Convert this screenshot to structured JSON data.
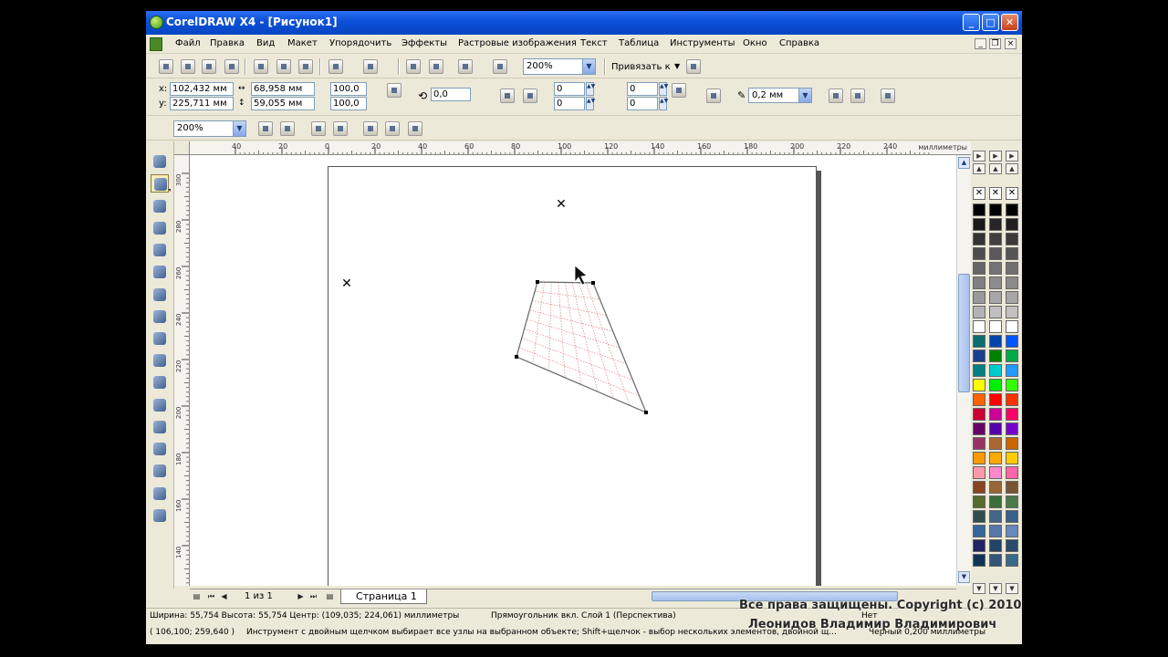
{
  "window": {
    "title": "CorelDRAW X4 - [Рисунок1]",
    "controls": {
      "minimize": "_",
      "maximize": "□",
      "close": "✕"
    }
  },
  "menu": {
    "items": [
      "Файл",
      "Правка",
      "Вид",
      "Макет",
      "Упорядочить",
      "Эффекты",
      "Растровые изображения",
      "Текст",
      "Таблица",
      "Инструменты",
      "Окно",
      "Справка"
    ]
  },
  "standard_toolbar": {
    "zoom_value": "200%",
    "snap_label": "Привязать к"
  },
  "property_bar": {
    "x_label": "x:",
    "y_label": "y:",
    "x_value": "102,432 мм",
    "y_value": "225,711 мм",
    "width_value": "68,958 мм",
    "height_value": "59,055 мм",
    "scale_x": "100,0",
    "scale_y": "100,0",
    "rotation": "0,0",
    "count_a": "0",
    "count_b": "0",
    "count_c": "0",
    "count_d": "0",
    "outline_width": "0,2 мм"
  },
  "zoom_toolbar": {
    "zoom_value": "200%"
  },
  "ruler": {
    "unit": "миллиметры",
    "h_labels": [
      "40",
      "20",
      "0",
      "20",
      "40",
      "60",
      "80",
      "100",
      "120",
      "140",
      "160",
      "180",
      "200",
      "220",
      "240"
    ],
    "v_labels": [
      "300",
      "280",
      "260",
      "240",
      "220",
      "200",
      "180",
      "160",
      "140"
    ]
  },
  "canvas": {
    "marker_glyph": "✕"
  },
  "page_nav": {
    "counter": "1 из 1",
    "tab_label": "Страница 1",
    "first": "⏮",
    "prev": "◀",
    "next": "▶",
    "last": "⏭"
  },
  "status": {
    "line1_left": "Ширина: 55,754  Высота: 55,754  Центр: (109,035; 224,061)  миллиметры",
    "line1_right": "Прямоугольник вкл. Слой 1 (Перспектива)",
    "line2_coords": "( 106,100; 259,640 )",
    "line2_hint": "Инструмент с двойным щелчком выбирает все узлы на выбранном объекте; Shift+щелчок - выбор нескольких элементов, двойной щ...",
    "fill_state": "Нет",
    "outline_state": "Черный  0,200 миллиметры"
  },
  "watermark": {
    "line1": "Все права защищены. Copyright (c) 2010",
    "line2": "Леонидов Владимир Владимирович"
  },
  "colors": {
    "title_bar": "#0a4fd8",
    "chrome": "#ece9d8",
    "grid": "#e06a6a",
    "shape_stroke": "#666666"
  },
  "palette_colors_a": [
    "#000000",
    "#1a1a1a",
    "#333333",
    "#4d4d4d",
    "#666666",
    "#808080",
    "#999999",
    "#b3b3b3",
    "#ffffff",
    "#0a6e6e",
    "#1a3f8f",
    "#008080",
    "#ffff00",
    "#ff6600",
    "#cc0033",
    "#660066",
    "#993366",
    "#ff9900",
    "#ff99aa",
    "#884422",
    "#556b2f",
    "#2f4f4f",
    "#336699",
    "#222266",
    "#113355",
    "#0a2f6e"
  ],
  "palette_colors_b": [
    "#000000",
    "#262626",
    "#404040",
    "#595959",
    "#737373",
    "#8c8c8c",
    "#a6a6a6",
    "#bfbfbf",
    "#ffffff",
    "#0044aa",
    "#008000",
    "#00cccc",
    "#00ee00",
    "#ff0000",
    "#cc0099",
    "#5500aa",
    "#aa6633",
    "#ffaa00",
    "#ff88cc",
    "#996633",
    "#3c6e3c",
    "#446688",
    "#5577aa",
    "#224466",
    "#335577",
    "#113344"
  ],
  "palette_colors_c": [
    "#000000",
    "#1f1f1f",
    "#3a3a3a",
    "#555555",
    "#707070",
    "#8b8b8b",
    "#a6a6a6",
    "#c1c1c1",
    "#ffffff",
    "#0055ff",
    "#00aa44",
    "#2299ff",
    "#33ff00",
    "#ff3300",
    "#ff0066",
    "#7700cc",
    "#cc6600",
    "#ffcc00",
    "#ff66aa",
    "#775533",
    "#4a7a4a",
    "#3a5f8a",
    "#6688bb",
    "#2a4a6a",
    "#3a6a8a",
    "#0f2a44"
  ]
}
